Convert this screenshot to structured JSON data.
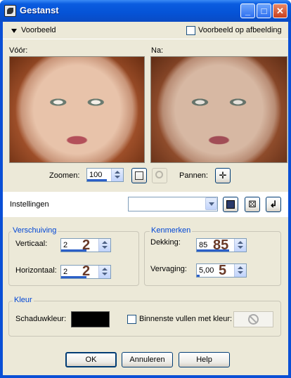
{
  "window": {
    "title": "Gestanst",
    "min_label": "_",
    "max_label": "□",
    "close_label": "✕"
  },
  "preview": {
    "toggle_label": "Voorbeeld",
    "on_image_label": "Voorbeeld op afbeelding",
    "before_label": "Vóór:",
    "after_label": "Na:",
    "zoom_label": "Zoomen:",
    "zoom_value": "100",
    "pan_label": "Pannen:"
  },
  "settings": {
    "label": "Instellingen",
    "preset_value": ""
  },
  "offset": {
    "title": "Verschuiving",
    "vertical_label": "Verticaal:",
    "vertical_value": "2",
    "vertical_annotation": "2",
    "horizontal_label": "Horizontaal:",
    "horizontal_value": "2",
    "horizontal_annotation": "2"
  },
  "properties": {
    "title": "Kenmerken",
    "opacity_label": "Dekking:",
    "opacity_value": "85",
    "opacity_annotation": "85",
    "blur_label": "Vervaging:",
    "blur_value": "5,00",
    "blur_annotation": "5"
  },
  "color": {
    "title": "Kleur",
    "shadow_label": "Schaduwkleur:",
    "shadow_color": "#000000",
    "fill_label": "Binnenste vullen met kleur:"
  },
  "buttons": {
    "ok": "OK",
    "cancel": "Annuleren",
    "help": "Help"
  },
  "accent": "#0046d5"
}
